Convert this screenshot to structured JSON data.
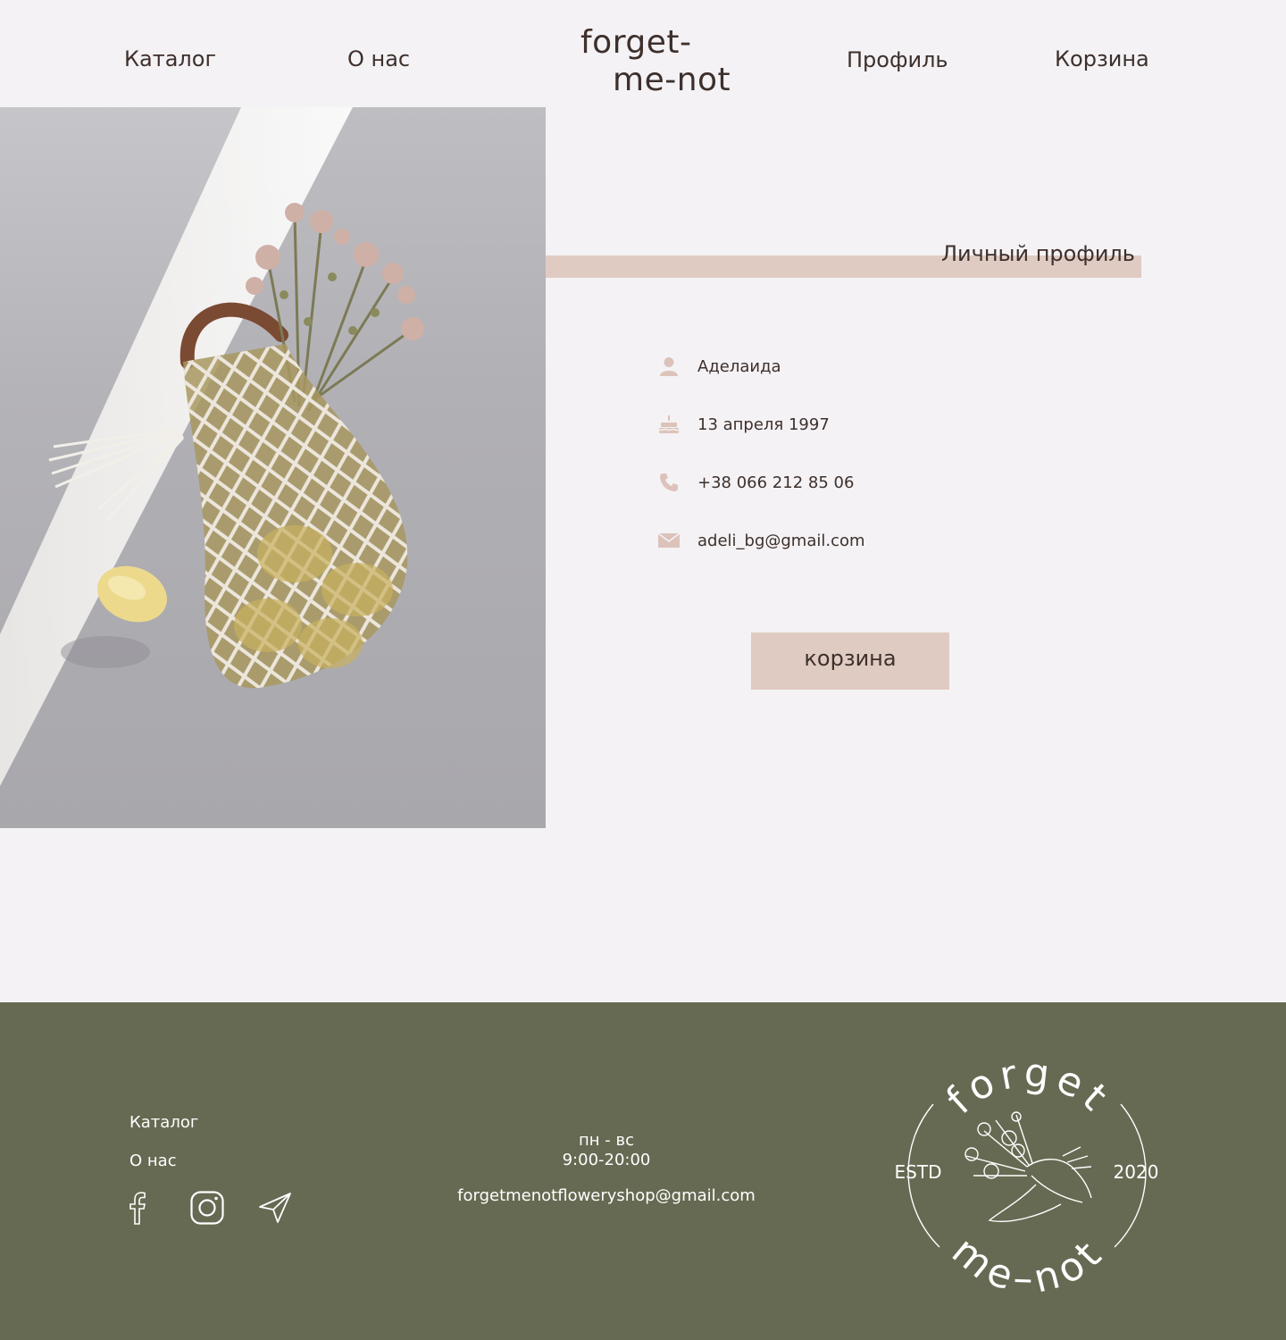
{
  "header": {
    "nav": [
      "Каталог",
      "О нас",
      "Профиль",
      "Корзина"
    ],
    "logo_line1": "forget-",
    "logo_line2": "me-not"
  },
  "profile": {
    "title": "Личный профиль",
    "name": "Аделаида",
    "birthday": "13 апреля 1997",
    "phone": "+38 066 212 85 06",
    "email": "adeli_bg@gmail.com",
    "cart_button": "корзина",
    "accent_color": "#e0cbc2"
  },
  "footer": {
    "links": [
      "Каталог",
      "О нас"
    ],
    "hours_days": "пн - вс",
    "hours_time": "9:00-20:00",
    "email": "forgetmenotfloweryshop@gmail.com",
    "social_icons": [
      "facebook-icon",
      "instagram-icon",
      "telegram-icon"
    ],
    "emblem_top": "forget",
    "emblem_bottom": "me–not",
    "emblem_left": "ESTD",
    "emblem_right": "2020",
    "background_color": "#666a52"
  }
}
